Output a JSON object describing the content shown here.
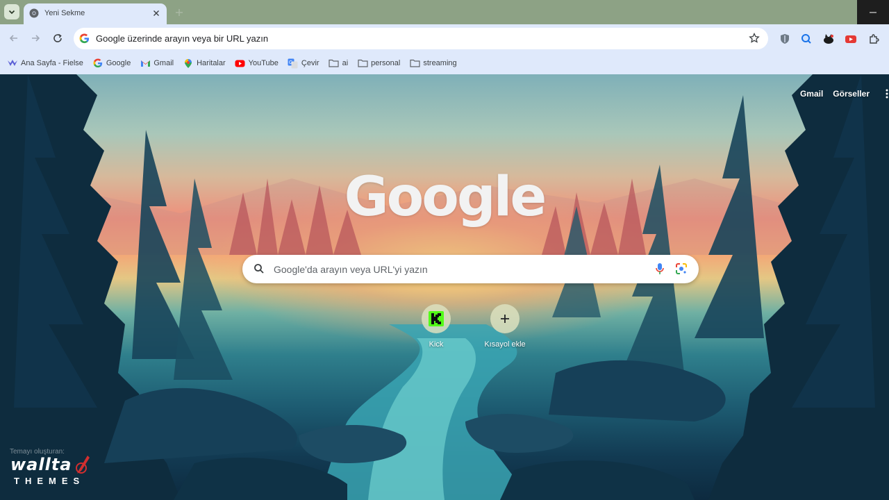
{
  "tab": {
    "title": "Yeni Sekme"
  },
  "omnibox": {
    "placeholder": "Google üzerinde arayın veya bir URL yazın"
  },
  "bookmarks": [
    {
      "label": "Ana Sayfa - Fielse",
      "icon": "fielse-icon"
    },
    {
      "label": "Google",
      "icon": "google-icon"
    },
    {
      "label": "Gmail",
      "icon": "gmail-icon"
    },
    {
      "label": "Haritalar",
      "icon": "maps-icon"
    },
    {
      "label": "YouTube",
      "icon": "youtube-icon"
    },
    {
      "label": "Çevir",
      "icon": "translate-icon"
    },
    {
      "label": "ai",
      "icon": "folder-icon"
    },
    {
      "label": "personal",
      "icon": "folder-icon"
    },
    {
      "label": "streaming",
      "icon": "folder-icon"
    }
  ],
  "ntp": {
    "links": {
      "gmail": "Gmail",
      "images": "Görseller"
    },
    "logo": "Google",
    "search_placeholder": "Google'da arayın veya URL'yi yazın",
    "shortcuts": [
      {
        "label": "Kick",
        "icon": "kick-icon"
      },
      {
        "label": "Kısayol ekle",
        "icon": "plus-icon"
      }
    ],
    "theme_credit": "Temayı oluşturan:",
    "theme_brand": "wallta",
    "theme_brand_sub": "THEMES"
  },
  "colors": {
    "chrome_frame": "#8da285",
    "toolbar": "#dfe9fb",
    "kick_green": "#53fc18",
    "youtube_red": "#ff0000"
  }
}
